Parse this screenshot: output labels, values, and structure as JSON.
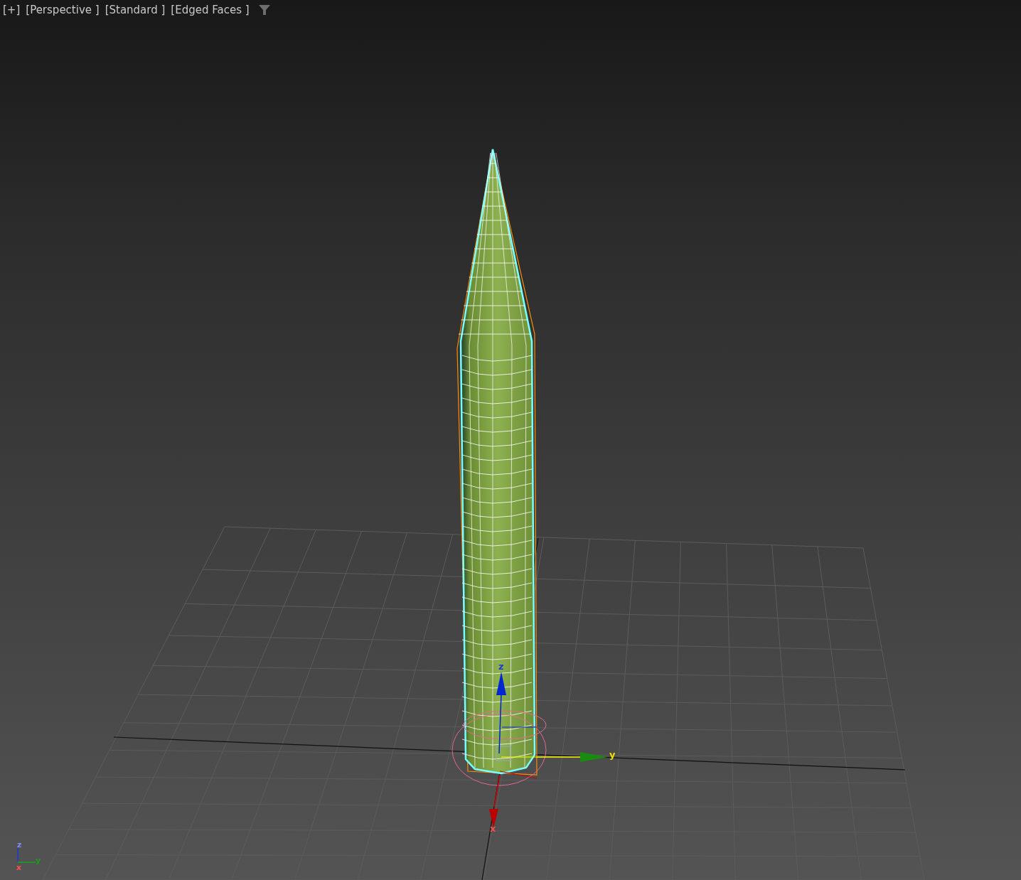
{
  "viewport": {
    "labels": [
      "[+]",
      "[Perspective ]",
      "[Standard ]",
      "[Edged Faces ]"
    ],
    "gizmo_labels": [
      "z",
      "y",
      "x"
    ],
    "tripod_labels": [
      "z",
      "y",
      "x"
    ]
  }
}
